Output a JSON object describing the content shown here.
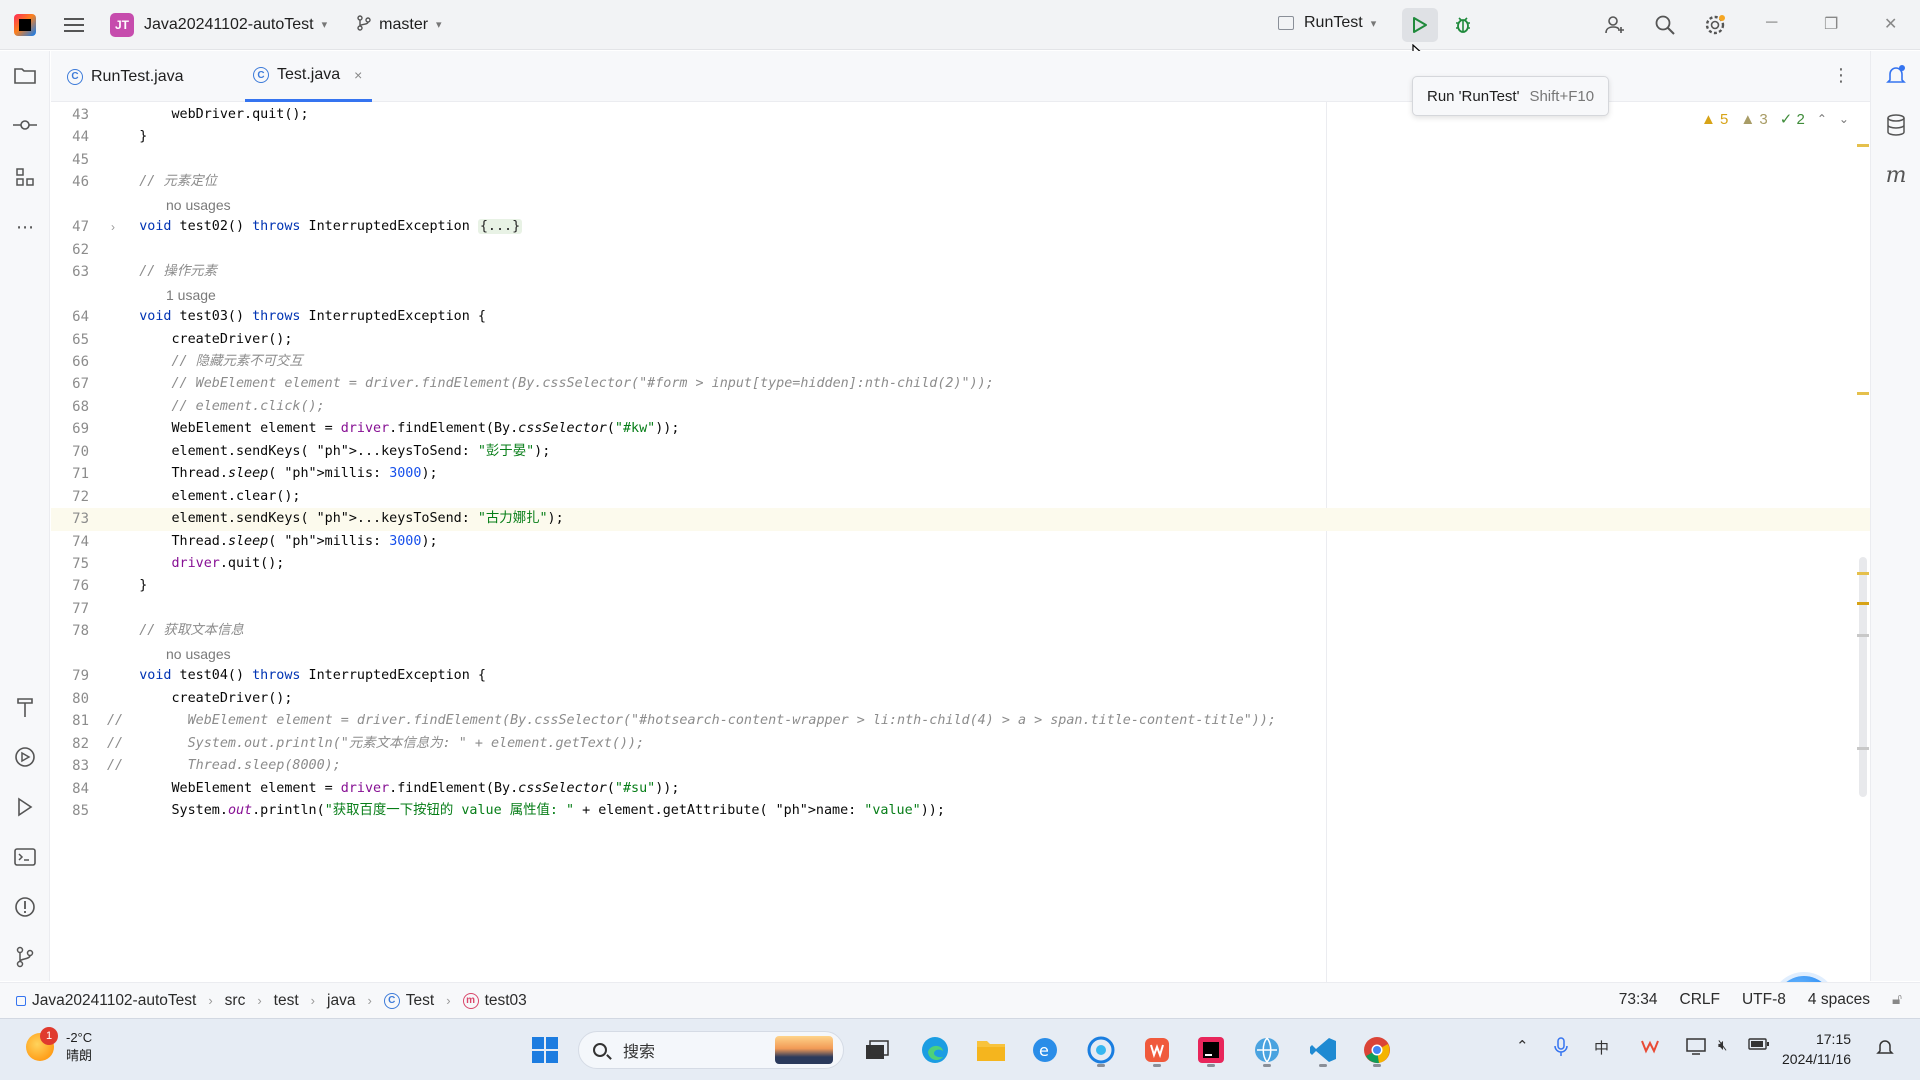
{
  "titlebar": {
    "project_badge": "JT",
    "project_name": "Java20241102-autoTest",
    "branch": "master",
    "run_config": "RunTest"
  },
  "tooltip": {
    "text": "Run 'RunTest'",
    "shortcut": "Shift+F10"
  },
  "tabs": [
    {
      "label": "RunTest.java",
      "active": false
    },
    {
      "label": "Test.java",
      "active": true,
      "close": "×"
    }
  ],
  "inspections": {
    "warnings": "5",
    "weak_warnings": "3",
    "ok": "2"
  },
  "editor": {
    "lines": [
      {
        "num": "43",
        "html": "        webDriver.quit();"
      },
      {
        "num": "44",
        "html": "    }"
      },
      {
        "num": "45",
        "html": ""
      },
      {
        "num": "46",
        "html": "    // 元素定位",
        "comment": true
      },
      {
        "hint": "no usages"
      },
      {
        "num": "47",
        "html": "    void test02() throws InterruptedException {...}",
        "fold": true
      },
      {
        "num": "62",
        "html": ""
      },
      {
        "num": "63",
        "html": "    // 操作元素",
        "comment": true
      },
      {
        "hint": "1 usage"
      },
      {
        "num": "64",
        "html": "    void test03() throws InterruptedException {"
      },
      {
        "num": "65",
        "html": "        createDriver();"
      },
      {
        "num": "66",
        "html": "        // 隐藏元素不可交互",
        "comment": true
      },
      {
        "num": "67",
        "html": "        // WebElement element = driver.findElement(By.cssSelector(\"#form > input[type=hidden]:nth-child(2)\"));",
        "comment": true
      },
      {
        "num": "68",
        "html": "        // element.click();",
        "comment": true
      },
      {
        "num": "69",
        "html": "        WebElement element = driver.findElement(By.cssSelector(\"#kw\"));"
      },
      {
        "num": "70",
        "html": "        element.sendKeys( ...keysToSend: \"彭于晏\");"
      },
      {
        "num": "71",
        "html": "        Thread.sleep( millis: 3000);"
      },
      {
        "num": "72",
        "html": "        element.clear();"
      },
      {
        "num": "73",
        "html": "        element.sendKeys( ...keysToSend: \"古力娜扎\");",
        "current": true
      },
      {
        "num": "74",
        "html": "        Thread.sleep( millis: 3000);"
      },
      {
        "num": "75",
        "html": "        driver.quit();"
      },
      {
        "num": "76",
        "html": "    }"
      },
      {
        "num": "77",
        "html": ""
      },
      {
        "num": "78",
        "html": "    // 获取文本信息",
        "comment": true
      },
      {
        "hint": "no usages"
      },
      {
        "num": "79",
        "html": "    void test04() throws InterruptedException {"
      },
      {
        "num": "80",
        "html": "        createDriver();"
      },
      {
        "num": "81",
        "html": "//        WebElement element = driver.findElement(By.cssSelector(\"#hotsearch-content-wrapper > li:nth-child(4) > a > span.title-content-title\"));",
        "comment": true
      },
      {
        "num": "82",
        "html": "//        System.out.println(\"元素文本信息为: \" + element.getText());",
        "comment": true
      },
      {
        "num": "83",
        "html": "//        Thread.sleep(8000);",
        "comment": true
      },
      {
        "num": "84",
        "html": "        WebElement element = driver.findElement(By.cssSelector(\"#su\"));"
      },
      {
        "num": "85",
        "html": "        System.out.println(\"获取百度一下按钮的 value 属性值: \" + element.getAttribute( name: \"value\"));"
      }
    ]
  },
  "statusbar": {
    "breadcrumb": [
      "Java20241102-autoTest",
      "src",
      "test",
      "java",
      "Test",
      "test03"
    ],
    "position": "73:34",
    "line_sep": "CRLF",
    "encoding": "UTF-8",
    "indent": "4 spaces"
  },
  "taskbar": {
    "weather_temp": "-2°C",
    "weather_desc": "晴朗",
    "weather_badge": "1",
    "search_placeholder": "搜索",
    "time": "17:15",
    "date": "2024/11/16"
  },
  "colors": {
    "keyword": "#0033b3",
    "comment": "#8c8c8c",
    "string": "#067d17",
    "number": "#1750eb",
    "field": "#871094",
    "accent": "#3574f0",
    "run_green": "#208a3c"
  }
}
